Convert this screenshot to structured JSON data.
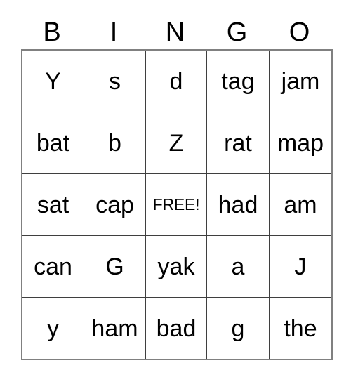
{
  "card": {
    "title": "BINGO",
    "headers": [
      "B",
      "I",
      "N",
      "G",
      "O"
    ],
    "free_space_label": "FREE!",
    "free_space_position": {
      "row": 2,
      "col": 2
    },
    "text_color": "#000000",
    "background_color": "#ffffff",
    "grid_line_color": "#3f3f3f",
    "outer_border_color": "#808080",
    "rows": [
      {
        "cells": [
          {
            "text": "Y",
            "free": false
          },
          {
            "text": "s",
            "free": false
          },
          {
            "text": "d",
            "free": false
          },
          {
            "text": "tag",
            "free": false
          },
          {
            "text": "jam",
            "free": false
          }
        ]
      },
      {
        "cells": [
          {
            "text": "bat",
            "free": false
          },
          {
            "text": "b",
            "free": false
          },
          {
            "text": "Z",
            "free": false
          },
          {
            "text": "rat",
            "free": false
          },
          {
            "text": "map",
            "free": false
          }
        ]
      },
      {
        "cells": [
          {
            "text": "sat",
            "free": false
          },
          {
            "text": "cap",
            "free": false
          },
          {
            "text": "FREE!",
            "free": true
          },
          {
            "text": "had",
            "free": false
          },
          {
            "text": "am",
            "free": false
          }
        ]
      },
      {
        "cells": [
          {
            "text": "can",
            "free": false
          },
          {
            "text": "G",
            "free": false
          },
          {
            "text": "yak",
            "free": false
          },
          {
            "text": "a",
            "free": false
          },
          {
            "text": "J",
            "free": false
          }
        ]
      },
      {
        "cells": [
          {
            "text": "y",
            "free": false
          },
          {
            "text": "ham",
            "free": false
          },
          {
            "text": "bad",
            "free": false
          },
          {
            "text": "g",
            "free": false
          },
          {
            "text": "the",
            "free": false
          }
        ]
      }
    ]
  }
}
